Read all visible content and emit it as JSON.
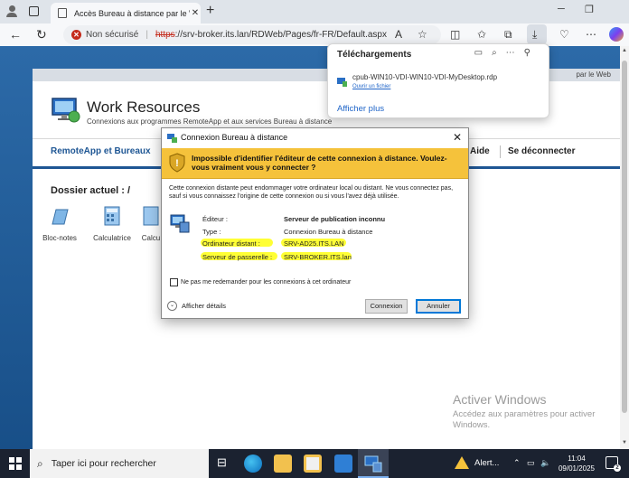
{
  "browser": {
    "tab_title": "Accès Bureau à distance par le W",
    "new_tab_glyph": "+",
    "window_controls": [
      "─",
      "❐"
    ],
    "security_label": "Non sécurisé",
    "url_scheme": "https",
    "url_rest": "://srv-broker.its.lan/RDWeb/Pages/fr-FR/Default.aspx",
    "toolbar_icons": [
      "read-aloud-icon",
      "favorite-star-icon",
      "split-screen-icon",
      "favorites-icon",
      "collections-icon",
      "downloads-icon",
      "browser-essentials-icon",
      "copilot-icon"
    ]
  },
  "page": {
    "header_tag": "par le Web",
    "title": "Work Resources",
    "subtitle": "Connexions aux programmes RemoteApp et aux services Bureau à distance",
    "menu": {
      "remoteapp": "RemoteApp et Bureaux",
      "help": "Aide",
      "logout": "Se déconnecter"
    },
    "current_folder": "Dossier actuel : /",
    "apps": [
      {
        "label": "Bloc-notes",
        "icon": "notepad-icon"
      },
      {
        "label": "Calculatrice",
        "icon": "calculator-icon"
      },
      {
        "label": "Calcu",
        "icon": "calculator-icon"
      }
    ],
    "activation": {
      "line1": "Activer Windows",
      "line2": "Accédez aux paramètres pour activer",
      "line3": "Windows."
    }
  },
  "downloads": {
    "title": "Téléchargements",
    "file_name": "cpub-WIN10-VDI-WIN10-VDI-MyDesktop.rdp",
    "open_file": "Ouvrir un fichier",
    "show_more": "Afficher plus"
  },
  "dialog": {
    "title": "Connexion Bureau à distance",
    "warning": "Impossible d'identifier l'éditeur de cette connexion à distance. Voulez-vous vraiment vous y connecter ?",
    "description": "Cette connexion distante peut endommager votre ordinateur local ou distant. Ne vous connectez pas, sauf si vous connaissez l'origine de cette connexion ou si vous l'avez déjà utilisée.",
    "fields": [
      {
        "label": "Éditeur :",
        "value": "Serveur de publication inconnu"
      },
      {
        "label": "Type :",
        "value": "Connexion Bureau à distance"
      },
      {
        "label": "Ordinateur distant :",
        "value": "SRV-AD25.ITS.LAN"
      },
      {
        "label": "Serveur de passerelle :",
        "value": "SRV-BROKER.ITS.lan"
      }
    ],
    "dont_ask": "Ne pas me redemander pour les connexions à cet ordinateur",
    "show_details": "Afficher détails",
    "connect": "Connexion",
    "cancel": "Annuler",
    "highlight_color": "#ffff35",
    "warning_color": "#f5c23b"
  },
  "taskbar": {
    "search_placeholder": "Taper ici pour rechercher",
    "alert_label": "Alert...",
    "time": "11:04",
    "date": "09/01/2025",
    "notification_count": "2"
  }
}
